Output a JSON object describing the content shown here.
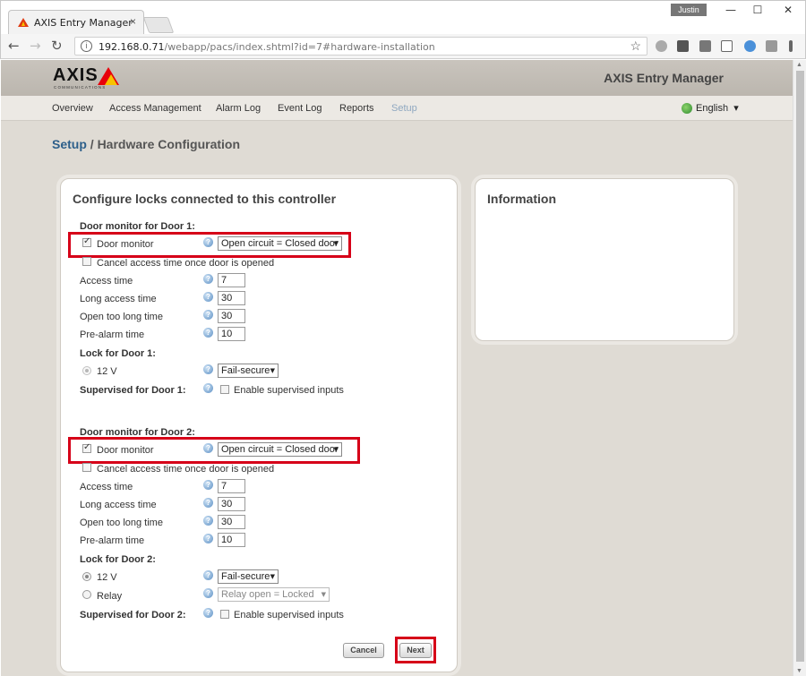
{
  "browser": {
    "tab_title": "AXIS Entry Manager",
    "tab_close": "×",
    "profile_name": "Justin",
    "minimize": "—",
    "maximize": "☐",
    "close": "✕",
    "url_host": "192.168.0.71",
    "url_path": "/webapp/pacs/index.shtml?id=7#hardware-installation",
    "back": "←",
    "forward": "→",
    "reload": "↻",
    "star": "☆",
    "info": "i"
  },
  "header": {
    "logo_word": "AXIS",
    "logo_sub": "COMMUNICATIONS",
    "app_title": "AXIS Entry Manager"
  },
  "nav": {
    "items": [
      "Overview",
      "Access Management",
      "Alarm Log",
      "Event Log",
      "Reports",
      "Setup"
    ],
    "active": "Setup",
    "language": "English",
    "language_arrow": "▾"
  },
  "breadcrumb": {
    "link": "Setup",
    "separator": " / ",
    "current": "Hardware Configuration"
  },
  "config_panel": {
    "title": "Configure locks connected to this controller",
    "door1": {
      "section_title": "Door monitor for Door 1:",
      "door_monitor_label": "Door monitor",
      "door_monitor_checked": true,
      "door_monitor_option": "Open circuit = Closed door",
      "cancel_access_label": "Cancel access time once door is opened",
      "access_time_label": "Access time",
      "access_time": "7",
      "long_access_label": "Long access time",
      "long_access": "30",
      "open_too_long_label": "Open too long time",
      "open_too_long": "30",
      "pre_alarm_label": "Pre-alarm time",
      "pre_alarm": "10",
      "lock_title": "Lock for Door 1:",
      "lock_12v_label": "12 V",
      "lock_mode": "Fail-secure",
      "supervised_title": "Supervised for Door 1:",
      "supervised_label": "Enable supervised inputs"
    },
    "door2": {
      "section_title": "Door monitor for Door 2:",
      "door_monitor_label": "Door monitor",
      "door_monitor_checked": true,
      "door_monitor_option": "Open circuit = Closed door",
      "cancel_access_label": "Cancel access time once door is opened",
      "access_time_label": "Access time",
      "access_time": "7",
      "long_access_label": "Long access time",
      "long_access": "30",
      "open_too_long_label": "Open too long time",
      "open_too_long": "30",
      "pre_alarm_label": "Pre-alarm time",
      "pre_alarm": "10",
      "lock_title": "Lock for Door 2:",
      "lock_12v_label": "12 V",
      "lock_mode": "Fail-secure",
      "relay_label": "Relay",
      "relay_option": "Relay open = Locked",
      "supervised_title": "Supervised for Door 2:",
      "supervised_label": "Enable supervised inputs"
    },
    "cancel_button": "Cancel",
    "next_button": "Next",
    "help_glyph": "?",
    "select_arrow": "▼"
  },
  "info_panel": {
    "title": "Information"
  },
  "colors": {
    "highlight": "#d60018",
    "link": "#2d5f8a",
    "active_nav": "#8fa8c0"
  }
}
